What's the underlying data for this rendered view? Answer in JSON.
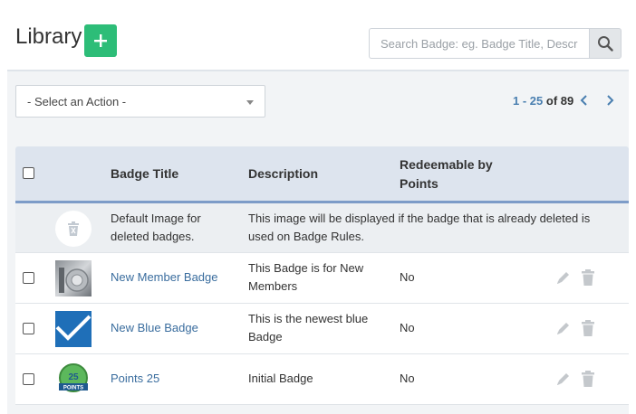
{
  "header": {
    "title": "Library"
  },
  "search": {
    "placeholder": "Search Badge: eg. Badge Title, Description"
  },
  "actions": {
    "selected": "- Select an Action -"
  },
  "pagination": {
    "range": "1 - 25",
    "of": "of",
    "total": "89"
  },
  "table": {
    "columns": {
      "title": "Badge Title",
      "description": "Description",
      "redeemable": "Redeemable by Points"
    },
    "default_row": {
      "title": "Default Image for deleted badges.",
      "description": "This image will be displayed if the badge that is already deleted is used on Badge Rules."
    },
    "rows": [
      {
        "title": "New Member Badge",
        "description": "This Badge is for New Members",
        "redeemable": "No"
      },
      {
        "title": "New Blue Badge",
        "description": "This is the newest blue Badge",
        "redeemable": "No"
      },
      {
        "title": "Points 25",
        "description": "Initial Badge",
        "redeemable": "No"
      }
    ],
    "badge_25_text": "25",
    "badge_points_text": "POINTS"
  },
  "colors": {
    "accent": "#2dbd78",
    "link": "#3a6d9e",
    "header_border": "#7d9cc8"
  }
}
